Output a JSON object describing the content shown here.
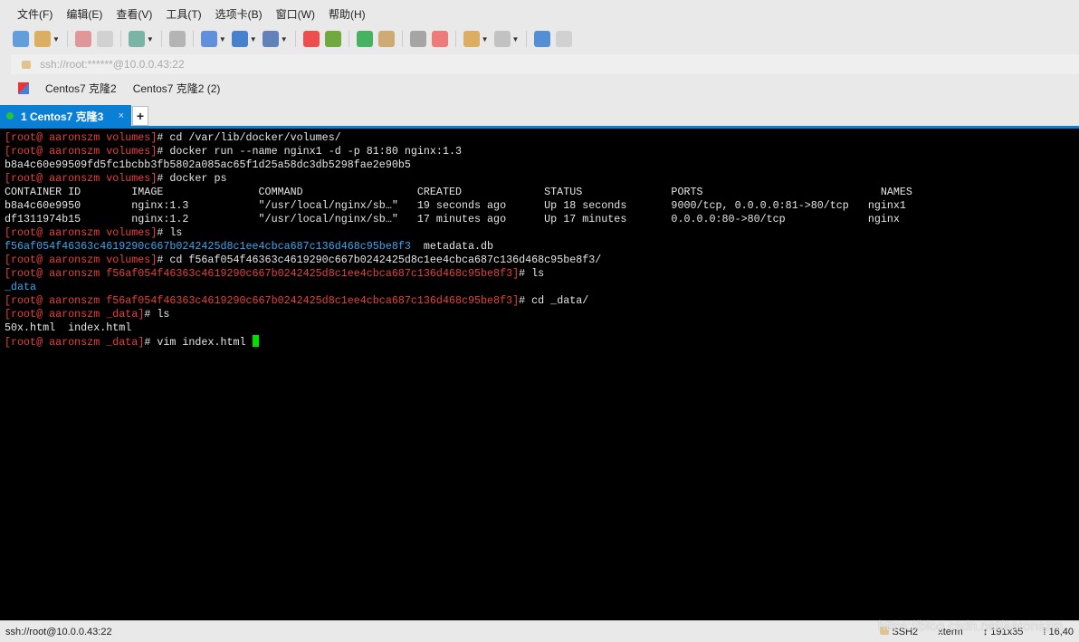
{
  "menu": [
    "文件(F)",
    "编辑(E)",
    "查看(V)",
    "工具(T)",
    "选项卡(B)",
    "窗口(W)",
    "帮助(H)"
  ],
  "toolbar_icons": [
    {
      "name": "new-session-icon",
      "color": "#4a90d9"
    },
    {
      "name": "open-folder-icon",
      "color": "#d9a34a",
      "dd": true
    },
    {
      "sep": true
    },
    {
      "name": "disconnect-icon",
      "color": "#d88"
    },
    {
      "name": "reconnect-icon",
      "color": "#ccc"
    },
    {
      "sep": true
    },
    {
      "name": "properties-icon",
      "color": "#6a9",
      "dd": true
    },
    {
      "sep": true
    },
    {
      "name": "find-icon",
      "color": "#aaa"
    },
    {
      "sep": true
    },
    {
      "name": "transfer-icon",
      "color": "#4a7fd6",
      "dd": true
    },
    {
      "name": "globe-icon",
      "color": "#2a6fc9",
      "dd": true
    },
    {
      "name": "font-icon",
      "color": "#4a6fb0",
      "dd": true
    },
    {
      "sep": true
    },
    {
      "name": "xftp-icon",
      "color": "#e33"
    },
    {
      "name": "xagent-icon",
      "color": "#5a9e1e"
    },
    {
      "sep": true
    },
    {
      "name": "fullscreen-icon",
      "color": "#2aa84a"
    },
    {
      "name": "lock-icon",
      "color": "#c9a060"
    },
    {
      "sep": true
    },
    {
      "name": "keyboard-icon",
      "color": "#999"
    },
    {
      "name": "highlight-icon",
      "color": "#e66"
    },
    {
      "sep": true
    },
    {
      "name": "new-tab-group-icon",
      "color": "#d9a34a",
      "dd": true
    },
    {
      "name": "layout-icon",
      "color": "#bbb",
      "dd": true
    },
    {
      "sep": true
    },
    {
      "name": "help-icon",
      "color": "#3a7fd0"
    },
    {
      "name": "chat-icon",
      "color": "#ccc"
    }
  ],
  "address": "ssh://root:******@10.0.0.43:22",
  "links": [
    "Centos7 克隆2",
    "Centos7 克隆2 (2)"
  ],
  "tab": {
    "label": "1 Centos7 克隆3",
    "close": "×",
    "add": "+"
  },
  "terminal": [
    [
      [
        "r",
        "[root@ aaronszm volumes]"
      ],
      [
        "",
        "# cd /var/lib/docker/volumes/"
      ]
    ],
    [
      [
        "r",
        "[root@ aaronszm volumes]"
      ],
      [
        "",
        "# docker run --name nginx1 -d -p 81:80 nginx:1.3"
      ]
    ],
    [
      [
        "",
        "b8a4c60e99509fd5fc1bcbb3fb5802a085ac65f1d25a58dc3db5298fae2e90b5"
      ]
    ],
    [
      [
        "r",
        "[root@ aaronszm volumes]"
      ],
      [
        "",
        "# docker ps"
      ]
    ],
    [
      [
        "",
        "CONTAINER ID        IMAGE               COMMAND                  CREATED             STATUS              PORTS                            NAMES"
      ]
    ],
    [
      [
        "",
        "b8a4c60e9950        nginx:1.3           \"/usr/local/nginx/sb…\"   19 seconds ago      Up 18 seconds       9000/tcp, 0.0.0.0:81->80/tcp   nginx1"
      ]
    ],
    [
      [
        "",
        "df1311974b15        nginx:1.2           \"/usr/local/nginx/sb…\"   17 minutes ago      Up 17 minutes       0.0.0.0:80->80/tcp             nginx"
      ]
    ],
    [
      [
        "r",
        "[root@ aaronszm volumes]"
      ],
      [
        "",
        "# ls"
      ]
    ],
    [
      [
        "b",
        "f56af054f46363c4619290c667b0242425d8c1ee4cbca687c136d468c95be8f3"
      ],
      [
        "",
        "  metadata.db"
      ]
    ],
    [
      [
        "r",
        "[root@ aaronszm volumes]"
      ],
      [
        "",
        "# cd f56af054f46363c4619290c667b0242425d8c1ee4cbca687c136d468c95be8f3/"
      ]
    ],
    [
      [
        "r",
        "[root@ aaronszm f56af054f46363c4619290c667b0242425d8c1ee4cbca687c136d468c95be8f3]"
      ],
      [
        "",
        "# ls"
      ]
    ],
    [
      [
        "b",
        "_data"
      ]
    ],
    [
      [
        "r",
        "[root@ aaronszm f56af054f46363c4619290c667b0242425d8c1ee4cbca687c136d468c95be8f3]"
      ],
      [
        "",
        "# cd _data/"
      ]
    ],
    [
      [
        "r",
        "[root@ aaronszm _data]"
      ],
      [
        "",
        "# ls"
      ]
    ],
    [
      [
        "",
        "50x.html  index.html"
      ]
    ],
    [
      [
        "r",
        "[root@ aaronszm _data]"
      ],
      [
        "",
        "# vim index.html "
      ]
    ]
  ],
  "colors": {
    "prompt": "#e8403c",
    "directory": "#3aa8f0",
    "cursor": "#00e000",
    "tab": "#0a7fd6"
  },
  "status": {
    "left": "ssh://root@10.0.0.43:22",
    "protocol": "SSH2",
    "term": "xterm",
    "size": "191x35",
    "pos": "16,40"
  },
  "watermark": "https://blog.csdn.net/aaronszm"
}
